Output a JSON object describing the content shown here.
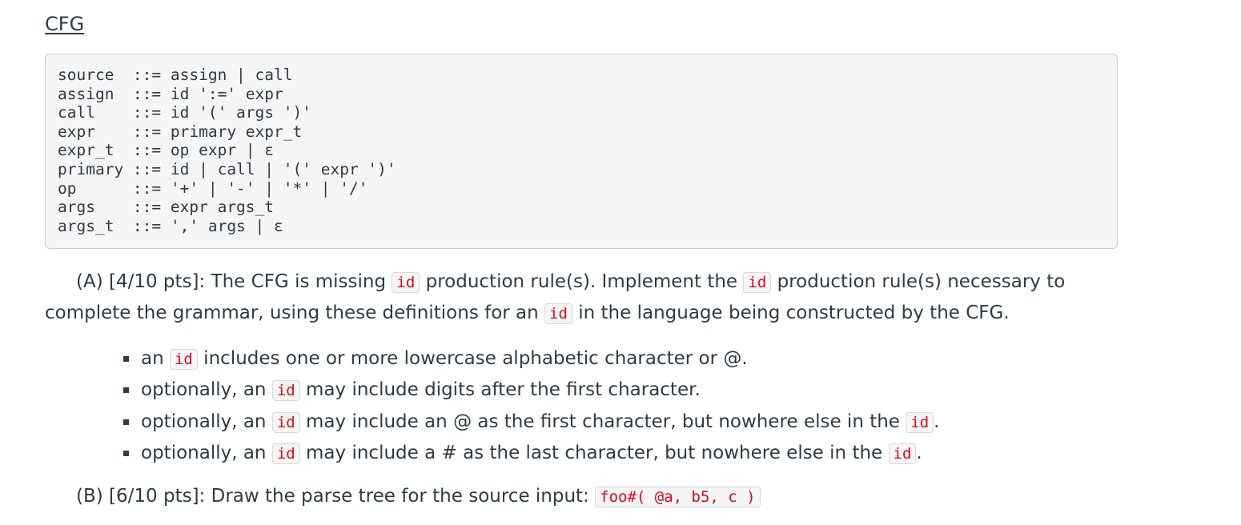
{
  "heading": "CFG",
  "grammar_lines": [
    "source  ::= assign | call",
    "assign  ::= id ':=' expr",
    "call    ::= id '(' args ')'",
    "expr    ::= primary expr_t",
    "expr_t  ::= op expr | ε",
    "primary ::= id | call | '(' expr ')'",
    "op      ::= '+' | '-' | '*' | '/'",
    "args    ::= expr args_t",
    "args_t  ::= ',' args | ε"
  ],
  "part_a": {
    "t1": "(A) [4/10 pts]: The CFG is missing ",
    "c1": "id",
    "t2": " production rule(s).  Implement the ",
    "c2": "id",
    "t3": " production rule(s) necessary to complete the grammar, using these definitions for an ",
    "c3": "id",
    "t4": " in the language being constructed by the CFG."
  },
  "rules": [
    {
      "t1": "an ",
      "code": "id",
      "t2": " includes one or more lowercase alphabetic character or @.",
      "code2": "",
      "t3": ""
    },
    {
      "t1": "optionally, an ",
      "code": "id",
      "t2": " may include digits after the first character.",
      "code2": "",
      "t3": ""
    },
    {
      "t1": "optionally, an ",
      "code": "id",
      "t2": " may include an @ as the first character, but nowhere else in the ",
      "code2": "id",
      "t3": "."
    },
    {
      "t1": "optionally, an ",
      "code": "id",
      "t2": " may include a # as the last character, but nowhere else in the ",
      "code2": "id",
      "t3": "."
    }
  ],
  "part_b": {
    "text": "(B) [6/10 pts]:  Draw the parse tree for the source input: ",
    "code": "foo#( @a, b5, c )"
  }
}
